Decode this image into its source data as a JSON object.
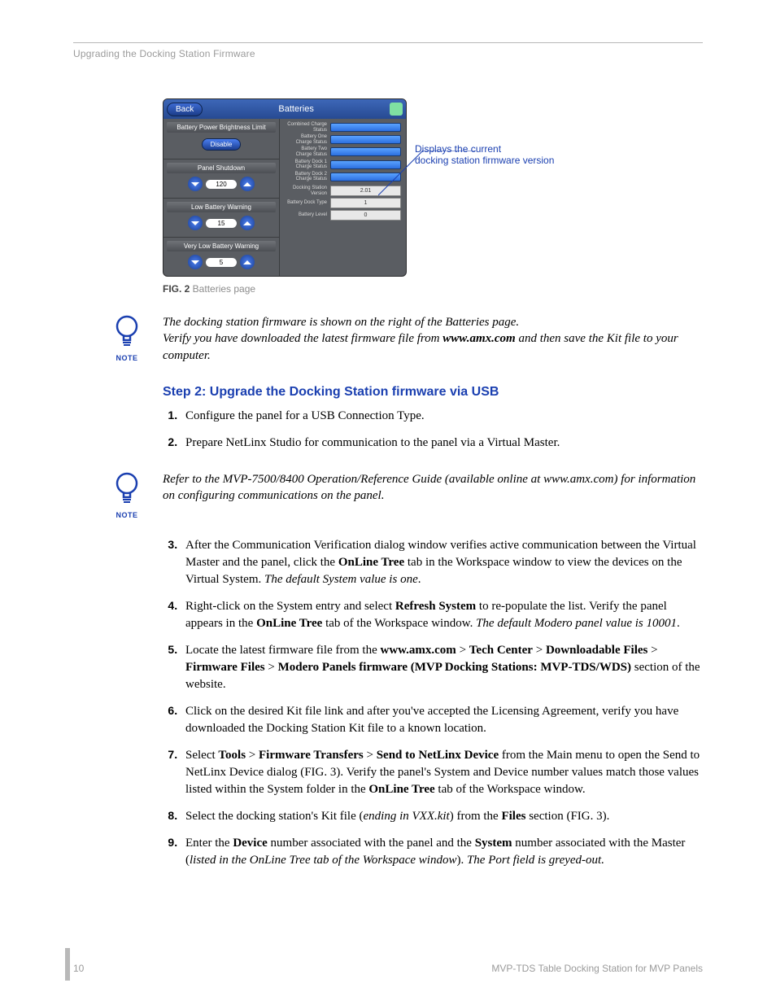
{
  "header": {
    "breadcrumb": "Upgrading the Docking Station Firmware"
  },
  "figure": {
    "backLabel": "Back",
    "title": "Batteries",
    "sect1": {
      "h": "Battery Power Brightness Limit",
      "btn": "Disable"
    },
    "sect2": {
      "h": "Panel Shutdown",
      "val": "120"
    },
    "sect3": {
      "h": "Low Battery Warning",
      "val": "15"
    },
    "sect4": {
      "h": "Very Low Battery Warning",
      "val": "5"
    },
    "rRows": [
      {
        "lbl": "Combined Charge Status"
      },
      {
        "lbl": "Battery One Charge Status"
      },
      {
        "lbl": "Battery Two Charge Status"
      },
      {
        "lbl": "Battery Dock 1 Charge Status"
      },
      {
        "lbl": "Battery Dock 2 Charge Status"
      }
    ],
    "vRows": [
      {
        "lbl": "Docking Station Version",
        "val": "2.01"
      },
      {
        "lbl": "Battery Dock Type",
        "val": "1"
      },
      {
        "lbl": "Battery Level",
        "val": "0"
      }
    ],
    "caption": {
      "bold": "FIG. 2",
      "rest": "  Batteries page"
    },
    "callout1": "Displays the current",
    "callout2": "docking station firmware version"
  },
  "note1": {
    "l1": "The docking station firmware is shown on the right of the Batteries page.",
    "l2a": "Verify you have downloaded the latest firmware file from ",
    "l2b": "www.amx.com",
    "l2c": " and then save the Kit file to your computer."
  },
  "stepTitle": "Step 2: Upgrade the Docking Station firmware via USB",
  "steps1": [
    "Configure the panel for a USB Connection Type.",
    "Prepare NetLinx Studio for communication to the panel via a Virtual Master."
  ],
  "note2": "Refer to the MVP-7500/8400 Operation/Reference Guide (available online at www.amx.com) for information on configuring communications on the panel.",
  "steps2": {
    "s3a": "After the Communication Verification dialog window verifies active communication between the Virtual Master and the panel, click the ",
    "s3b": "OnLine Tree",
    "s3c": " tab in the Workspace window to view the devices on the Virtual System. ",
    "s3d": "The default System value is one",
    "s3e": ".",
    "s4a": "Right-click on the System entry and select ",
    "s4b": "Refresh System",
    "s4c": " to re-populate the list. Verify the panel appears in the ",
    "s4d": "OnLine Tree",
    "s4e": " tab of the Workspace window. ",
    "s4f": "The default Modero panel value is 10001",
    "s4g": ".",
    "s5a": "Locate the latest firmware file from the ",
    "s5b": "www.amx.com",
    "s5c": " > ",
    "s5d": "Tech Center",
    "s5e": " > ",
    "s5f": "Downloadable Files",
    "s5g": " > ",
    "s5h": "Firmware Files",
    "s5i": " > ",
    "s5j": "Modero Panels firmware (MVP Docking Stations: MVP-TDS/WDS)",
    "s5k": " section of the website.",
    "s6": "Click on the desired Kit file link and after you've accepted the Licensing Agreement, verify you have downloaded the Docking Station Kit file to a known location.",
    "s7a": "Select ",
    "s7b": "Tools",
    "s7c": " > ",
    "s7d": "Firmware Transfers",
    "s7e": " > ",
    "s7f": "Send to NetLinx Device",
    "s7g": " from the Main menu to open the Send to NetLinx Device dialog (FIG. 3). Verify the panel's System and Device number values match those values listed within the System folder in the ",
    "s7h": "OnLine Tree",
    "s7i": " tab of the Workspace window.",
    "s8a": "Select the docking station's Kit file (",
    "s8b": "ending in VXX.kit",
    "s8c": ") from the ",
    "s8d": "Files",
    "s8e": " section (FIG. 3).",
    "s9a": "Enter the ",
    "s9b": "Device",
    "s9c": " number associated with the panel and the ",
    "s9d": "System",
    "s9e": " number associated with the Master (",
    "s9f": "listed in the OnLine Tree tab of the Workspace window",
    "s9g": "). ",
    "s9h": "The Port field is greyed-out."
  },
  "footer": {
    "page": "10",
    "doc": "MVP-TDS Table Docking Station for MVP Panels"
  },
  "noteLabel": "NOTE"
}
